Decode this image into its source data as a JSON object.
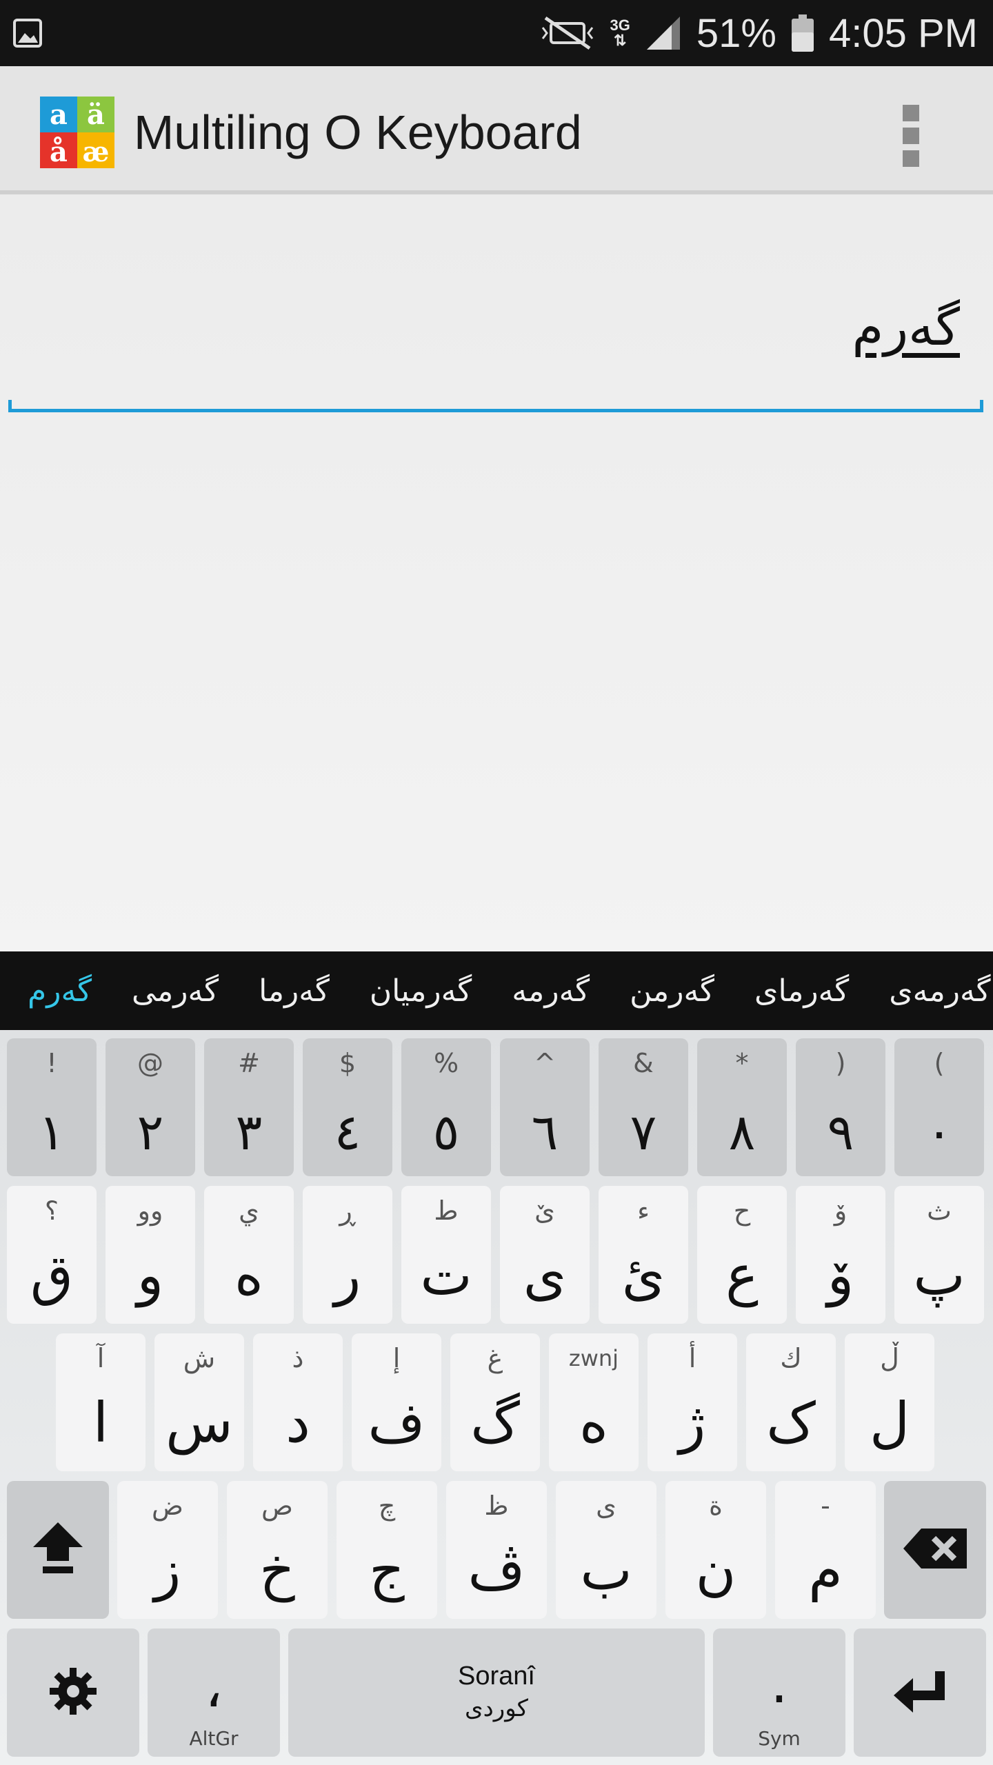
{
  "status_bar": {
    "battery": "51%",
    "time": "4:05 PM",
    "network": "3G",
    "icons": [
      "image-icon",
      "mute-icon",
      "network-3g-icon",
      "signal-icon",
      "battery-icon"
    ]
  },
  "app_bar": {
    "title": "Multiling O Keyboard",
    "logo_letters": [
      "a",
      "ä",
      "å",
      "æ"
    ],
    "logo_colors": [
      "#1e9bd7",
      "#8cc63f",
      "#e5332a",
      "#f7b500"
    ]
  },
  "editor": {
    "value": "گەرم",
    "accent_color": "#1e9bd7"
  },
  "suggestions": {
    "items": [
      "گەرم",
      "گەرمی",
      "گەرما",
      "گەرمیان",
      "گەرمە",
      "گەرمن",
      "گەرمای",
      "گەرمەی"
    ],
    "active_index": 0,
    "active_color": "#35c6e8"
  },
  "keyboard": {
    "row1": [
      {
        "hint": "!",
        "main": "١"
      },
      {
        "hint": "@",
        "main": "٢"
      },
      {
        "hint": "#",
        "main": "٣"
      },
      {
        "hint": "$",
        "main": "٤"
      },
      {
        "hint": "%",
        "main": "٥"
      },
      {
        "hint": "^",
        "main": "٦"
      },
      {
        "hint": "&",
        "main": "٧"
      },
      {
        "hint": "*",
        "main": "٨"
      },
      {
        "hint": ")",
        "main": "٩"
      },
      {
        "hint": "(",
        "main": "٠"
      }
    ],
    "row2": [
      {
        "hint": "؟",
        "main": "ق"
      },
      {
        "hint": "وو",
        "main": "و"
      },
      {
        "hint": "ي",
        "main": "ە"
      },
      {
        "hint": "ڕ",
        "main": "ر"
      },
      {
        "hint": "ط",
        "main": "ت"
      },
      {
        "hint": "ێ",
        "main": "ی"
      },
      {
        "hint": "ء",
        "main": "ئ"
      },
      {
        "hint": "ح",
        "main": "ع"
      },
      {
        "hint": "ۆ",
        "main": "ۆ"
      },
      {
        "hint": "ث",
        "main": "پ"
      }
    ],
    "row3": [
      {
        "hint": "آ",
        "main": "ا"
      },
      {
        "hint": "ش",
        "main": "س"
      },
      {
        "hint": "ذ",
        "main": "د"
      },
      {
        "hint": "إ",
        "main": "ف"
      },
      {
        "hint": "غ",
        "main": "گ"
      },
      {
        "hint": "zwnj",
        "main": "ه"
      },
      {
        "hint": "أ",
        "main": "ژ"
      },
      {
        "hint": "ك",
        "main": "ک"
      },
      {
        "hint": "ڵ",
        "main": "ل"
      }
    ],
    "row4": [
      {
        "hint": "ض",
        "main": "ز"
      },
      {
        "hint": "ص",
        "main": "خ"
      },
      {
        "hint": "چ",
        "main": "ج"
      },
      {
        "hint": "ظ",
        "main": "ڤ"
      },
      {
        "hint": "ى",
        "main": "ب"
      },
      {
        "hint": "ة",
        "main": "ن"
      },
      {
        "hint": "-",
        "main": "م"
      }
    ],
    "row5": {
      "comma_main": "،",
      "comma_sub": "AltGr",
      "space_line1": "Soranî",
      "space_line2": "کوردی",
      "period_main": ".",
      "period_sub": "Sym"
    }
  }
}
